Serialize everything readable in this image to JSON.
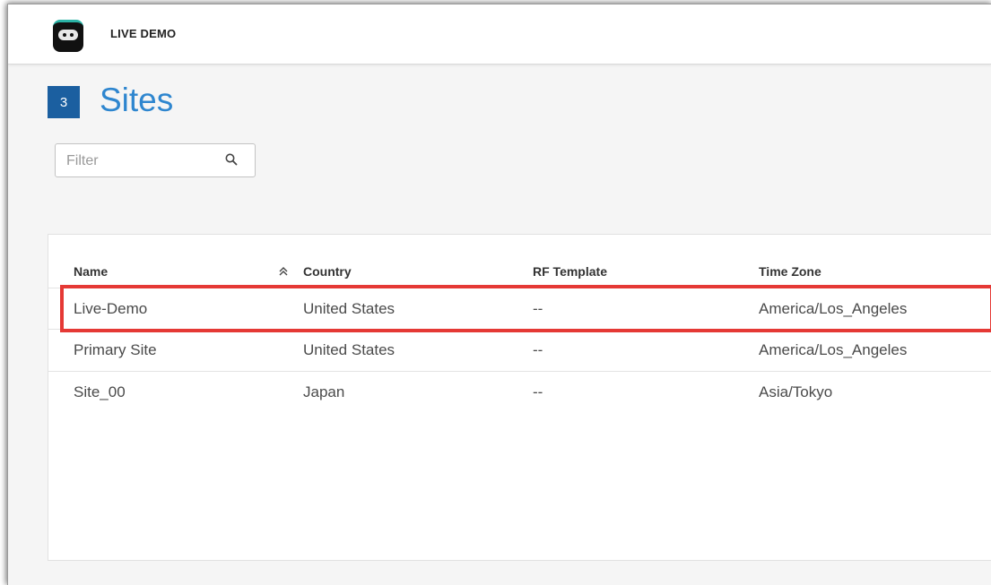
{
  "header": {
    "org_name": "LIVE DEMO",
    "logo_icon": "robot-logo-icon"
  },
  "page": {
    "count": "3",
    "title": "Sites"
  },
  "filter": {
    "placeholder": "Filter",
    "value": "",
    "icon": "search-icon"
  },
  "table": {
    "columns": [
      "Name",
      "Country",
      "RF Template",
      "Time Zone"
    ],
    "sort_icon": "sort-ascending-icon",
    "rows": [
      {
        "name": "Live-Demo",
        "country": "United States",
        "rf_template": "--",
        "time_zone": "America/Los_Angeles"
      },
      {
        "name": "Primary Site",
        "country": "United States",
        "rf_template": "--",
        "time_zone": "America/Los_Angeles"
      },
      {
        "name": "Site_00",
        "country": "Japan",
        "rf_template": "--",
        "time_zone": "Asia/Tokyo"
      }
    ]
  },
  "colors": {
    "accent": "#2e86cf",
    "badge": "#1b5fa0",
    "highlight": "#e53935"
  }
}
